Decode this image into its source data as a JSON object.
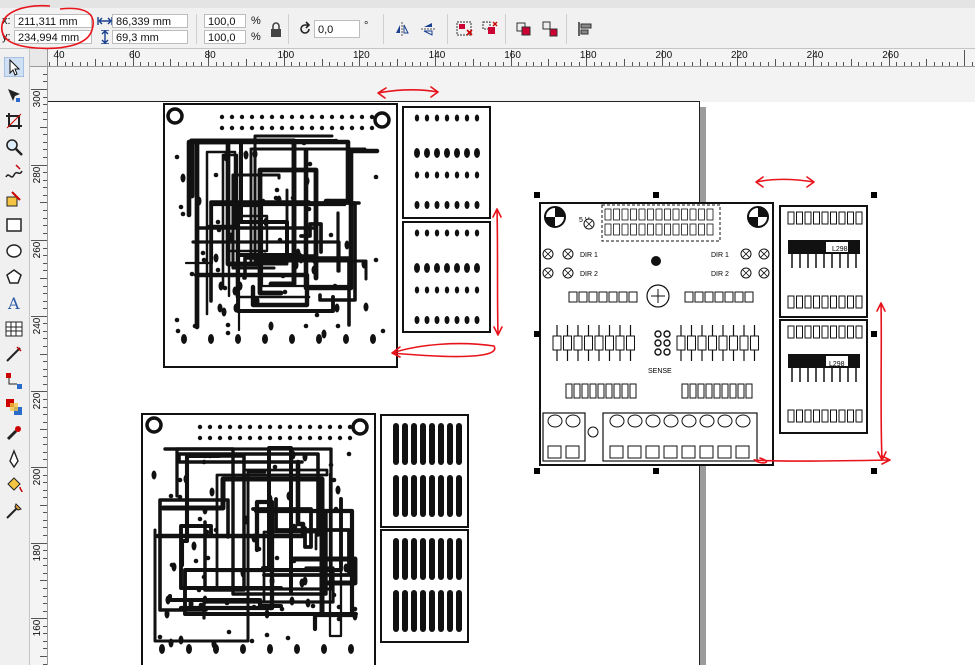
{
  "property_bar": {
    "x_label": "x:",
    "x_value": "211,311 mm",
    "y_label": "y:",
    "y_value": "234,994 mm",
    "width_value": "86,339 mm",
    "height_value": "69,3 mm",
    "scale_w": "100,0",
    "scale_h": "100,0",
    "percent": "%",
    "rotation_value": "0,0",
    "degree": "°"
  },
  "rulers": {
    "horizontal": [
      "40",
      "60",
      "80",
      "100",
      "120",
      "140",
      "160",
      "180",
      "200",
      "220",
      "240",
      "260"
    ],
    "vertical": [
      "300",
      "280",
      "260",
      "240",
      "220",
      "200",
      "180",
      "160"
    ]
  },
  "tools": [
    "pick-tool-icon",
    "shape-tool-icon",
    "crop-tool-icon",
    "zoom-tool-icon",
    "freehand-tool-icon",
    "smart-fill-icon",
    "rectangle-tool-icon",
    "ellipse-tool-icon",
    "polygon-tool-icon",
    "text-tool-icon",
    "table-tool-icon",
    "dimension-tool-icon",
    "connector-tool-icon",
    "blend-tool-icon",
    "eyedropper-icon",
    "outline-pen-icon",
    "fill-tool-icon",
    "interactive-fill-icon"
  ],
  "pcb": {
    "label_5v": "5 V",
    "label_dir1_left": "DIR 1",
    "label_dir2_left": "DIR 2",
    "label_dir1_right": "DIR 1",
    "label_dir2_right": "DIR 2",
    "label_sense": "SENSE",
    "label_l298_top": "L298",
    "label_l298_bottom": "L298"
  },
  "colors": {
    "annotation_red": "#e8141c",
    "selection_handle": "#000000"
  }
}
